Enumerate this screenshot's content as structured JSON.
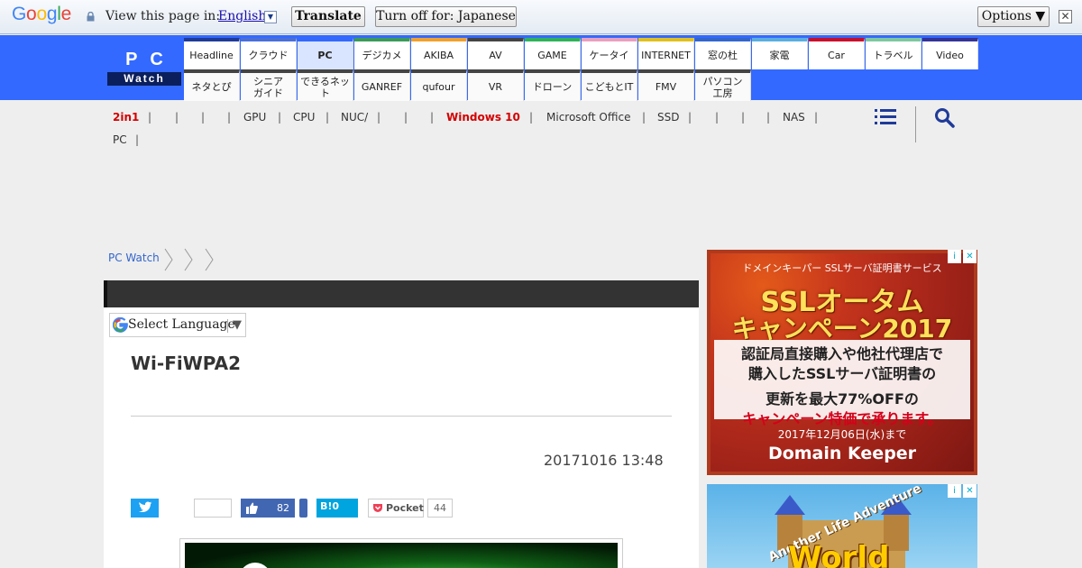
{
  "translate_bar": {
    "logo_letters": [
      "G",
      "o",
      "o",
      "g",
      "l",
      "e"
    ],
    "logo_colors": [
      "#4285f4",
      "#ea4335",
      "#fbbc05",
      "#4285f4",
      "#34a853",
      "#ea4335"
    ],
    "view_label": "View this page in:",
    "language": "English",
    "translate_label": "Translate",
    "turn_off_label": "Turn off for: Japanese",
    "options_label": "Options ▼",
    "close_symbol": "✕"
  },
  "header": {
    "logo_top": "PC",
    "logo_bottom": "Watch",
    "nav_row1": [
      {
        "label": "Headline",
        "color": "#1f3b99"
      },
      {
        "label": "クラウド",
        "color": "#4a6fd8"
      },
      {
        "label": "PC",
        "color": "#3369ff",
        "active": true
      },
      {
        "label": "デジカメ",
        "color": "#3a9a5a"
      },
      {
        "label": "AKIBA",
        "color": "#f0a030"
      },
      {
        "label": "AV",
        "color": "#444444"
      },
      {
        "label": "GAME",
        "color": "#2fb35a"
      },
      {
        "label": "ケータイ",
        "color": "#e8a0c0"
      },
      {
        "label": "INTERNET",
        "color": "#e0c020"
      },
      {
        "label": "窓の杜",
        "color": "#3366cc"
      },
      {
        "label": "家電",
        "color": "#5aaee0"
      },
      {
        "label": "Car",
        "color": "#c8102e"
      },
      {
        "label": "トラベル",
        "color": "#7ec8a0"
      },
      {
        "label": "Video",
        "color": "#333399"
      }
    ],
    "nav_row2": [
      {
        "label": "ネタとぴ",
        "color": "#444444"
      },
      {
        "label": "シニア\nガイド",
        "color": "#444444"
      },
      {
        "label": "できるネット",
        "color": "#444444"
      },
      {
        "label": "GANREF",
        "color": "#444444"
      },
      {
        "label": "qufour",
        "color": "#444444"
      },
      {
        "label": "VR",
        "color": "#444444"
      },
      {
        "label": "ドローン",
        "color": "#444444"
      },
      {
        "label": "こどもとIT",
        "color": "#444444"
      },
      {
        "label": "FMV",
        "color": "#444444"
      },
      {
        "label": "パソコン\n工房",
        "color": "#444444"
      }
    ]
  },
  "tags": {
    "items": [
      "2in1",
      "GPU",
      "CPU",
      "NUC/",
      "Windows 10",
      "Microsoft Office",
      "SSD",
      "NAS",
      "PC"
    ],
    "separator": "|"
  },
  "breadcrumb": {
    "home": "PC Watch"
  },
  "article": {
    "lang_select": "Select Language",
    "lang_arrow": "▼",
    "title": "Wi-FiWPA2",
    "date": "20171016 13:48",
    "fb_count": "82",
    "hb_label": "B!0",
    "pocket_label": "Pocket",
    "pocket_count": "44"
  },
  "ad1": {
    "small": "ドメインキーパー SSLサーバ証明書サービス",
    "big1": "SSLオータム",
    "big2": "キャンペーン2017",
    "line1": "認証局直接購入や他社代理店で",
    "line2": "購入したSSLサーバ証明書の",
    "line3": "更新を最大77%OFFの",
    "line4": "キャンペーン特価で承ります。",
    "date": "2017年12月06日(水)まで",
    "brand": "Domain Keeper"
  },
  "ad2": {
    "arc": "Another Life Adventure",
    "world": "World"
  },
  "ad_icons": {
    "info": "i",
    "close": "✕"
  }
}
